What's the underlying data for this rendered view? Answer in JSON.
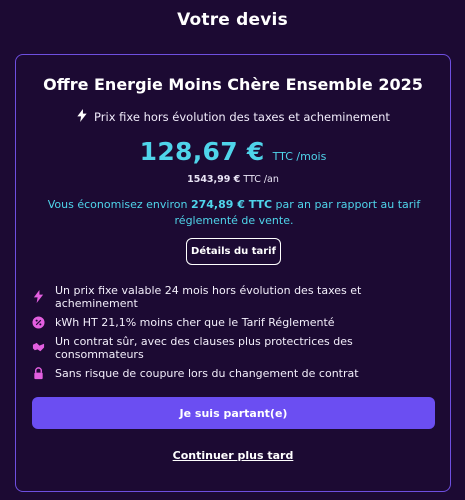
{
  "page": {
    "title": "Votre devis"
  },
  "offer": {
    "title": "Offre Energie Moins Chère Ensemble 2025",
    "subline": "Prix fixe hors évolution des taxes et acheminement",
    "subline_icon": "lightning-icon",
    "price_main": "128,67 €",
    "price_unit": "TTC /mois",
    "yearly_amount": "1543,99 €",
    "yearly_unit": "TTC /an",
    "savings_prefix": "Vous économisez environ",
    "savings_amount": "274,89 € TTC",
    "savings_suffix": "par an par rapport au tarif réglementé de vente.",
    "details_button": "Détails du tarif"
  },
  "features": [
    {
      "icon": "lightning-icon",
      "text": "Un prix fixe valable 24 mois hors évolution des taxes et acheminement"
    },
    {
      "icon": "percent-badge-icon",
      "text": "kWh HT 21,1% moins cher que le Tarif Réglementé"
    },
    {
      "icon": "handshake-icon",
      "text": "Un contrat sûr, avec des clauses plus protectrices des consommateurs"
    },
    {
      "icon": "lock-icon",
      "text": "Sans risque de coupure lors du changement de contrat"
    }
  ],
  "actions": {
    "primary": "Je suis partant(e)",
    "secondary": "Continuer plus tard"
  },
  "colors": {
    "background": "#1c0a33",
    "accent_cyan": "#4fd4ea",
    "accent_purple": "#6b4ef2",
    "icon_pink": "#e35fe0"
  }
}
